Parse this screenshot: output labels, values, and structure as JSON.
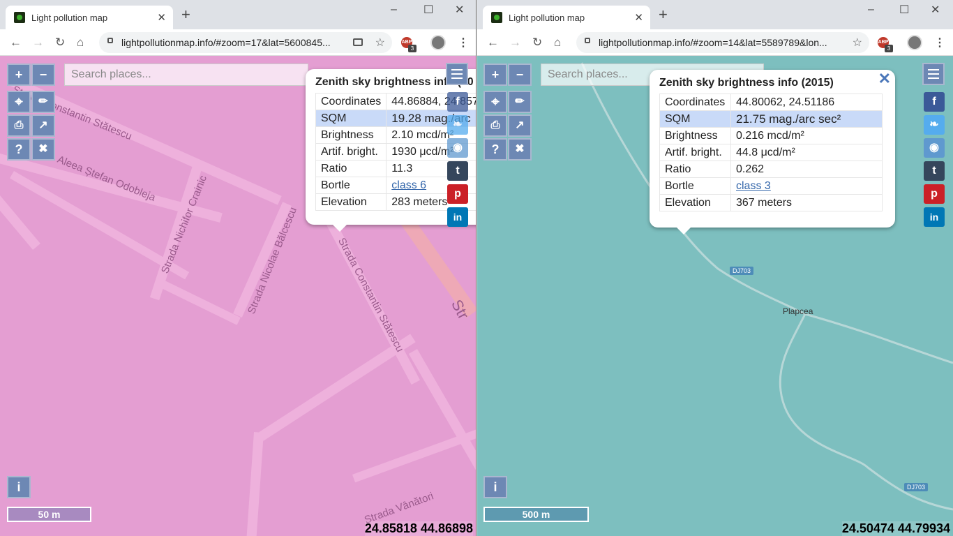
{
  "left_window": {
    "tab_title": "Light pollution map",
    "url": "lightpollutionmap.info/#zoom=17&lat=5600845...",
    "search_placeholder": "Search places...",
    "popup": {
      "title": "Zenith sky brightness info (20",
      "rows": [
        {
          "label": "Coordinates",
          "value": "44.86884, 24.857"
        },
        {
          "label": "SQM",
          "value": "19.28 mag./arc"
        },
        {
          "label": "Brightness",
          "value": "2.10 mcd/m²"
        },
        {
          "label": "Artif. bright.",
          "value": "1930 μcd/m²"
        },
        {
          "label": "Ratio",
          "value": "11.3"
        },
        {
          "label": "Bortle",
          "value": "class 6"
        },
        {
          "label": "Elevation",
          "value": "283 meters"
        }
      ]
    },
    "streets": {
      "s1": "Strada Constantin Stătescu",
      "s2": "Aleea Ștefan Odobleja",
      "s3": "Strada Nichifor Crainic",
      "s4": "Strada Nicolae Bălcescu",
      "s5": "Strada Constantin Stătescu",
      "s6": "Strada Vânători",
      "s7": "Str"
    },
    "scale": "50 m",
    "coords": "24.85818 44.86898",
    "ext_badge": "3"
  },
  "right_window": {
    "tab_title": "Light pollution map",
    "url": "lightpollutionmap.info/#zoom=14&lat=5589789&lon...",
    "search_placeholder": "Search places...",
    "popup": {
      "title": "Zenith sky brightness info (2015)",
      "close": "✕",
      "rows": [
        {
          "label": "Coordinates",
          "value": "44.80062, 24.51186"
        },
        {
          "label": "SQM",
          "value": "21.75 mag./arc sec²"
        },
        {
          "label": "Brightness",
          "value": "0.216 mcd/m²"
        },
        {
          "label": "Artif. bright.",
          "value": "44.8 μcd/m²"
        },
        {
          "label": "Ratio",
          "value": "0.262"
        },
        {
          "label": "Bortle",
          "value": "class 3"
        },
        {
          "label": "Elevation",
          "value": "367 meters"
        }
      ]
    },
    "place": "Plapcea",
    "road_shield": "DJ703",
    "scale": "500 m",
    "coords": "24.50474 44.79934",
    "ext_badge": "3"
  },
  "controls": {
    "zoom_in": "+",
    "zoom_out": "−",
    "help": "?",
    "info": "i",
    "tab_close": "✕",
    "new_tab": "+"
  },
  "colors": {
    "left_map": "#e49ed2",
    "right_map": "#7dbfbf",
    "control_bg": "#6d88b4",
    "popup_highlight": "#c9daf8",
    "facebook": "#3b5998",
    "twitter": "#55acee",
    "reddit": "#5f99cf",
    "tumblr": "#35465c",
    "pinterest": "#cb2027",
    "linkedin": "#0077b5"
  }
}
